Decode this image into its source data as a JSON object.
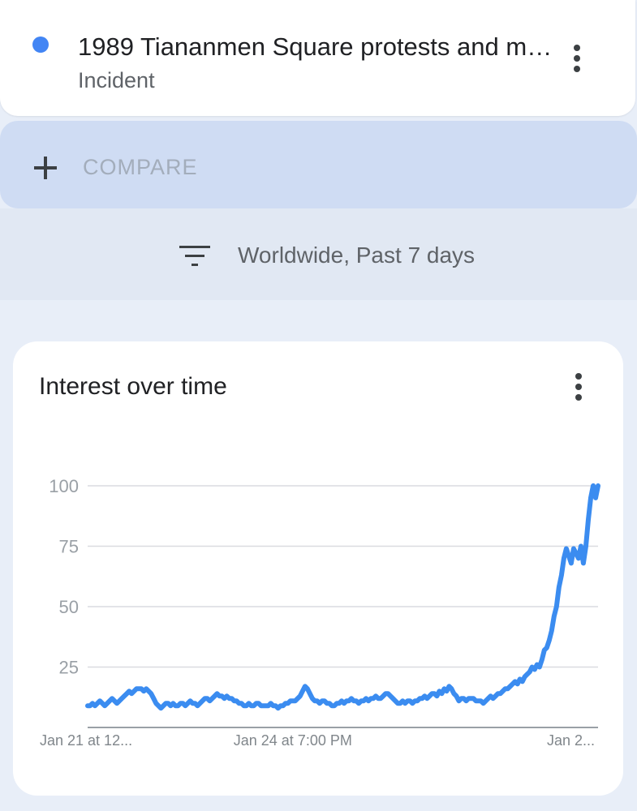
{
  "term": {
    "title": "1989 Tiananmen Square protests and ma...",
    "category": "Incident",
    "color": "#4285f4"
  },
  "compare": {
    "label": "COMPARE",
    "icon": "plus-icon"
  },
  "filter": {
    "label": "Worldwide, Past 7 days",
    "icon": "filter-icon"
  },
  "chart_card": {
    "title": "Interest over time",
    "menu_icon": "more-vert-icon"
  },
  "chart_data": {
    "type": "line",
    "title": "Interest over time",
    "xlabel": "",
    "ylabel": "",
    "ylim": [
      0,
      100
    ],
    "yticks": [
      25,
      50,
      75,
      100
    ],
    "xtick_labels": [
      "Jan 21 at 12...",
      "Jan 24 at 7:00 PM",
      "Jan 2..."
    ],
    "xtick_index": [
      0,
      84,
      168
    ],
    "grid": true,
    "color": "#3b8cf0",
    "series": [
      {
        "values": [
          9,
          9,
          10,
          9,
          10,
          11,
          10,
          9,
          10,
          11,
          12,
          11,
          10,
          11,
          12,
          13,
          14,
          15,
          14,
          15,
          16,
          16,
          16,
          15,
          16,
          15,
          14,
          12,
          10,
          9,
          8,
          9,
          10,
          10,
          9,
          10,
          9,
          9,
          10,
          10,
          9,
          10,
          11,
          10,
          10,
          9,
          10,
          11,
          12,
          12,
          11,
          12,
          13,
          14,
          13,
          13,
          12,
          13,
          12,
          12,
          11,
          11,
          10,
          10,
          9,
          9,
          10,
          9,
          9,
          10,
          10,
          9,
          9,
          9,
          9,
          10,
          9,
          9,
          8,
          9,
          9,
          10,
          10,
          11,
          11,
          11,
          12,
          13,
          15,
          17,
          16,
          14,
          12,
          11,
          11,
          10,
          11,
          11,
          10,
          10,
          9,
          9,
          10,
          10,
          11,
          10,
          11,
          11,
          12,
          11,
          11,
          10,
          11,
          11,
          12,
          11,
          12,
          12,
          13,
          12,
          12,
          13,
          14,
          14,
          13,
          12,
          11,
          10,
          10,
          11,
          10,
          11,
          11,
          10,
          11,
          11,
          12,
          12,
          13,
          12,
          13,
          14,
          14,
          13,
          15,
          14,
          16,
          15,
          17,
          16,
          14,
          13,
          11,
          12,
          12,
          11,
          12,
          12,
          12,
          11,
          11,
          11,
          10,
          11,
          12,
          13,
          12,
          13,
          14,
          14,
          15,
          16,
          16,
          17,
          18,
          19,
          18,
          20,
          19,
          21,
          22,
          23,
          25,
          24,
          26,
          25,
          28,
          32,
          33,
          36,
          40,
          46,
          50,
          58,
          63,
          70,
          74,
          71,
          68,
          74,
          72,
          70,
          75,
          68,
          75,
          86,
          95,
          100,
          95,
          100
        ]
      }
    ]
  }
}
